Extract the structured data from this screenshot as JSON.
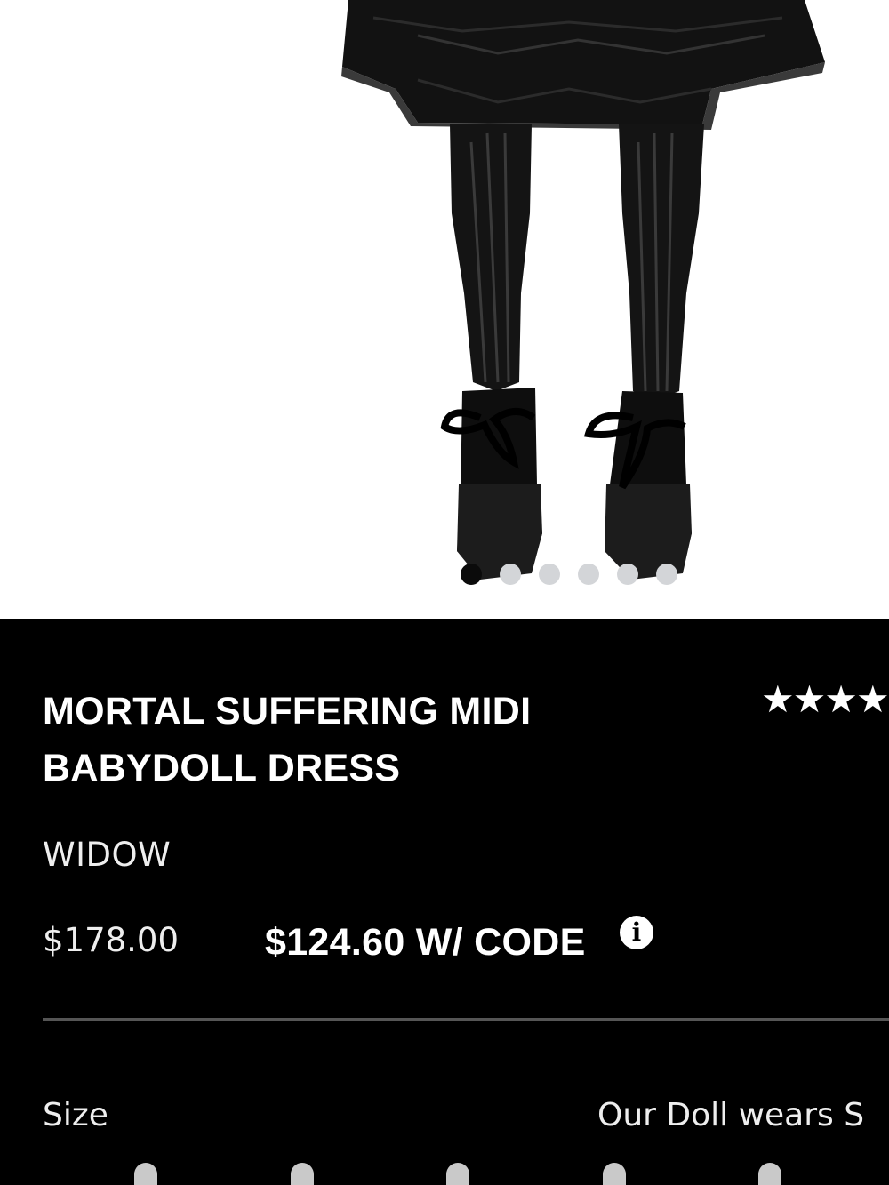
{
  "product": {
    "title": "MORTAL SUFFERING MIDI BABYDOLL DRESS",
    "rating_stars": "★★★★",
    "brand": "WIDOW",
    "original_price": "$178.00",
    "sale_price": "$124.60 W/ CODE",
    "info_icon_glyph": "i"
  },
  "gallery": {
    "image_count": 6,
    "active_index": 0
  },
  "size_section": {
    "label": "Size",
    "doll_wears": "Our Doll wears S"
  },
  "icons": {
    "info": "info-icon",
    "star": "star-icon"
  },
  "colors": {
    "panel_background": "#000000",
    "text": "#ffffff",
    "dot_active": "#0b0b0b",
    "dot_inactive": "#d3d5d8",
    "divider": "#555555"
  }
}
